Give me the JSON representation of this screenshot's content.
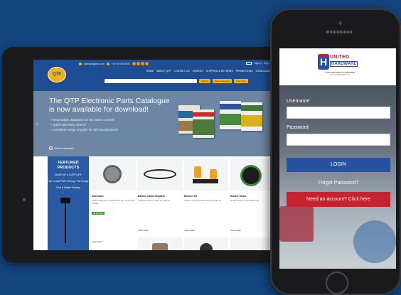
{
  "tablet": {
    "logo": "QTP",
    "contact": "sales@qtpinc.com",
    "phone": "+00 00 000 0000",
    "login_links": [
      "Sign in",
      "Sign up"
    ],
    "nav": [
      "HOME",
      "ABOUT QTP",
      "CONTACT US",
      "ORDERS",
      "SHIPPING & RETURNS",
      "PROMOTIONS",
      "CATALOGUES"
    ],
    "search_buttons": [
      "Search",
      "Select Category",
      "Shop Now"
    ],
    "hero": {
      "title": "The QTP Electronic Parts Catalogue is now available for download!",
      "bullets": [
        "Searchable database for the latest content",
        "Quick and easy search",
        "Complete range of parts for all manufacturers"
      ],
      "cta": "Click to download"
    },
    "featured": {
      "title": "FEATURED PRODUCTS",
      "subtitle": "MADE BY A SUPPLIER",
      "note": "HQ / Local Parts Pricing / Full Range",
      "note2": "Find A Dealer Nearby"
    },
    "products": [
      {
        "title": "Alternator",
        "desc": "Quality alternator replacement for most tractor models",
        "badge": "IN STOCK",
        "link": "View detail"
      },
      {
        "title": "Battery Cable Negative",
        "desc": "Negative battery cable for tractors",
        "badge": "",
        "link": "View detail"
      },
      {
        "title": "Beacon Kit",
        "desc": "Amber rotating beacon warning light kit",
        "badge": "",
        "link": "View detail"
      },
      {
        "title": "Blower Motor",
        "desc": "Heater blower motor assembly",
        "badge": "",
        "link": "View detail"
      }
    ],
    "colors": {
      "header": "#1e4d93",
      "accent": "#f4b018",
      "featured": "#2a5aa1"
    }
  },
  "phone": {
    "logo": {
      "letter": "H",
      "name_line1": "UNITED",
      "name_line2": "HARDWARE",
      "tagline": "YOUR PARTNER IN HARDWARE",
      "url": "www.unitedhardware.com"
    },
    "username_label": "Username",
    "password_label": "Password",
    "login_button": "LOGIN",
    "forgot_password": "Forgot Password?",
    "signup_button": "Need an account? Click here",
    "colors": {
      "login": "#2752a2",
      "signup": "#c52330"
    }
  }
}
